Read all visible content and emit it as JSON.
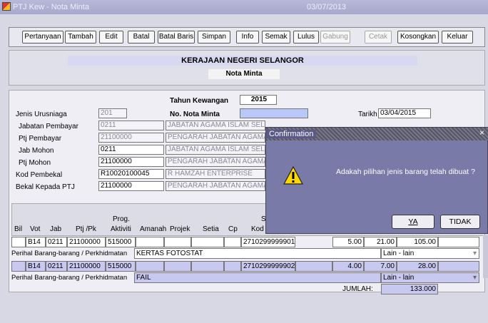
{
  "window": {
    "title": "PTJ Kew - Nota Minta",
    "date": "03/07/2013"
  },
  "toolbar": [
    "Pertanyaan",
    "Tambah",
    "Edit",
    "Batal",
    "Batal Baris",
    "Simpan",
    "Info",
    "Semak",
    "Lulus",
    "Gabung",
    "Cetak",
    "Kosongkan",
    "Keluar"
  ],
  "header": {
    "kerajaan": "KERAJAAN NEGERI SELANGOR",
    "nota": "Nota Minta"
  },
  "form": {
    "tahun_label": "Tahun Kewangan",
    "tahun": "2015",
    "no_nota_label": "No. Nota Minta",
    "no_nota": "",
    "tarikh_label": "Tarikh",
    "tarikh": "03/04/2015",
    "jenis_label": "Jenis Urusniaga",
    "jenis": "201",
    "jabatan_label": "Jabatan  Pembayar",
    "jabatan": "0211",
    "jabatan_desc": "JABATAN AGAMA ISLAM SELANGOR",
    "ptj_label": "Ptj Pembayar",
    "ptj": "21100000",
    "ptj_desc": "PENGARAH JABATAN AGAMA",
    "jab_mohon_label": "Jab Mohon",
    "jab_mohon": "0211",
    "jab_mohon_desc": "JABATAN AGAMA ISLAM SELA",
    "ptj_mohon_label": "Ptj Mohon",
    "ptj_mohon": "21100000",
    "ptj_mohon_desc": "PENGARAH JABATAN AGAMA",
    "kod_label": "Kod Pembekal",
    "kod": "R10020100045",
    "kod_desc": "R HAMZAH ENTERPRISE",
    "bekal_label": "Bekal Kepada PTJ",
    "bekal": "21100000",
    "bekal_desc": "PENGARAH JABATAN AGAMA"
  },
  "grid": {
    "headers": {
      "bil": "Bil",
      "vot": "Vot",
      "jab": "Jab",
      "ptj": "Ptj /Pk",
      "prog": "Prog.",
      "aktiviti": "Aktiviti",
      "amanah": "Amanah",
      "projek": "Projek",
      "setia": "Setia",
      "cp": "Cp",
      "so": "So",
      "kod": "Kod"
    },
    "rows": [
      {
        "vot": "B14",
        "jab": "0211",
        "ptj": "21100000",
        "prog": "515000",
        "kod": "2710299999901",
        "qty": "5.00",
        "price": "21.00",
        "total": "105.00",
        "perihal_label": "Perihal Barang-barang / Perkhidmatan",
        "perihal": "KERTAS FOTOSTAT",
        "jenis": "Lain - lain"
      },
      {
        "vot": "B14",
        "jab": "0211",
        "ptj": "21100000",
        "prog": "515000",
        "kod": "2710299999902",
        "qty": "4.00",
        "price": "7.00",
        "total": "28.00",
        "perihal_label": "Perihal Barang-barang / Perkhidmatan",
        "perihal": "FAIL",
        "jenis": "Lain - lain"
      }
    ],
    "jumlah_label": "JUMLAH:",
    "jumlah": "133.000"
  },
  "dialog": {
    "title": "Confirmation",
    "message": "Adakah pilihan jenis barang telah dibuat ?",
    "ya": "YA",
    "tidak": "TIDAK",
    "close": "×"
  }
}
